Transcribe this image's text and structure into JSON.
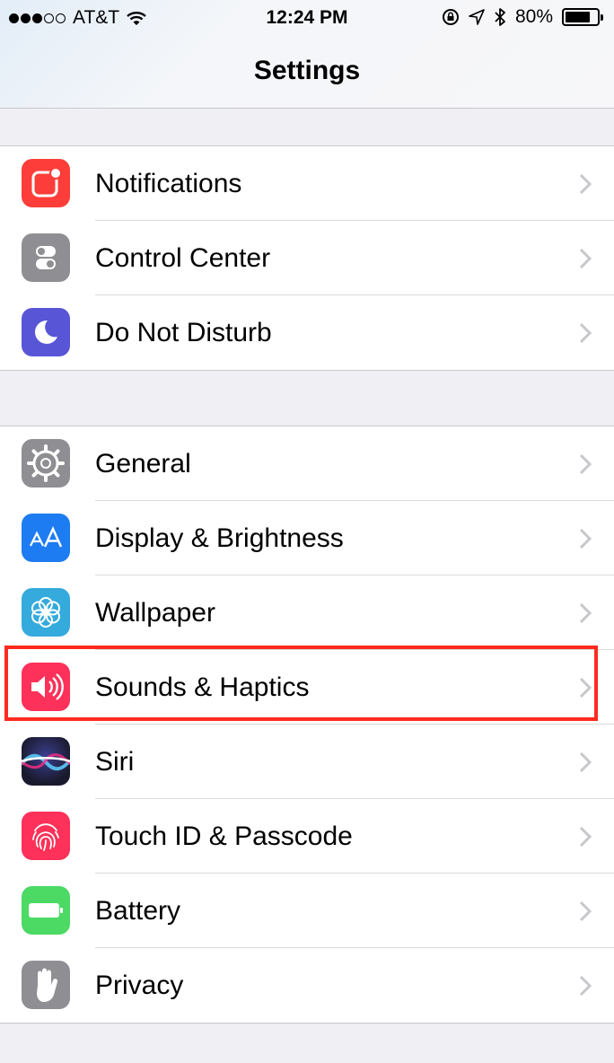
{
  "status_bar": {
    "carrier": "AT&T",
    "time": "12:24 PM",
    "battery_percent": "80%",
    "signal_bars_filled": 3,
    "signal_bars_total": 5,
    "battery_level": 0.8
  },
  "nav": {
    "title": "Settings"
  },
  "groups": [
    {
      "items": [
        {
          "label": "Notifications",
          "icon": "notifications-icon",
          "color": "#fc3d39"
        },
        {
          "label": "Control Center",
          "icon": "control-center-icon",
          "color": "#8e8e93"
        },
        {
          "label": "Do Not Disturb",
          "icon": "moon-icon",
          "color": "#5856d6"
        }
      ]
    },
    {
      "items": [
        {
          "label": "General",
          "icon": "gear-icon",
          "color": "#8e8e93"
        },
        {
          "label": "Display & Brightness",
          "icon": "text-size-icon",
          "color": "#1d7cf2"
        },
        {
          "label": "Wallpaper",
          "icon": "flower-icon",
          "color": "#35aadc"
        },
        {
          "label": "Sounds & Haptics",
          "icon": "speaker-icon",
          "color": "#fd3159"
        },
        {
          "label": "Siri",
          "icon": "siri-icon",
          "color": "#1a1a2e"
        },
        {
          "label": "Touch ID & Passcode",
          "icon": "fingerprint-icon",
          "color": "#fd3159"
        },
        {
          "label": "Battery",
          "icon": "battery-icon",
          "color": "#4cd964"
        },
        {
          "label": "Privacy",
          "icon": "hand-icon",
          "color": "#8e8e93"
        }
      ]
    }
  ],
  "highlight": {
    "target": "Sounds & Haptics",
    "color": "#ff2a1f"
  }
}
